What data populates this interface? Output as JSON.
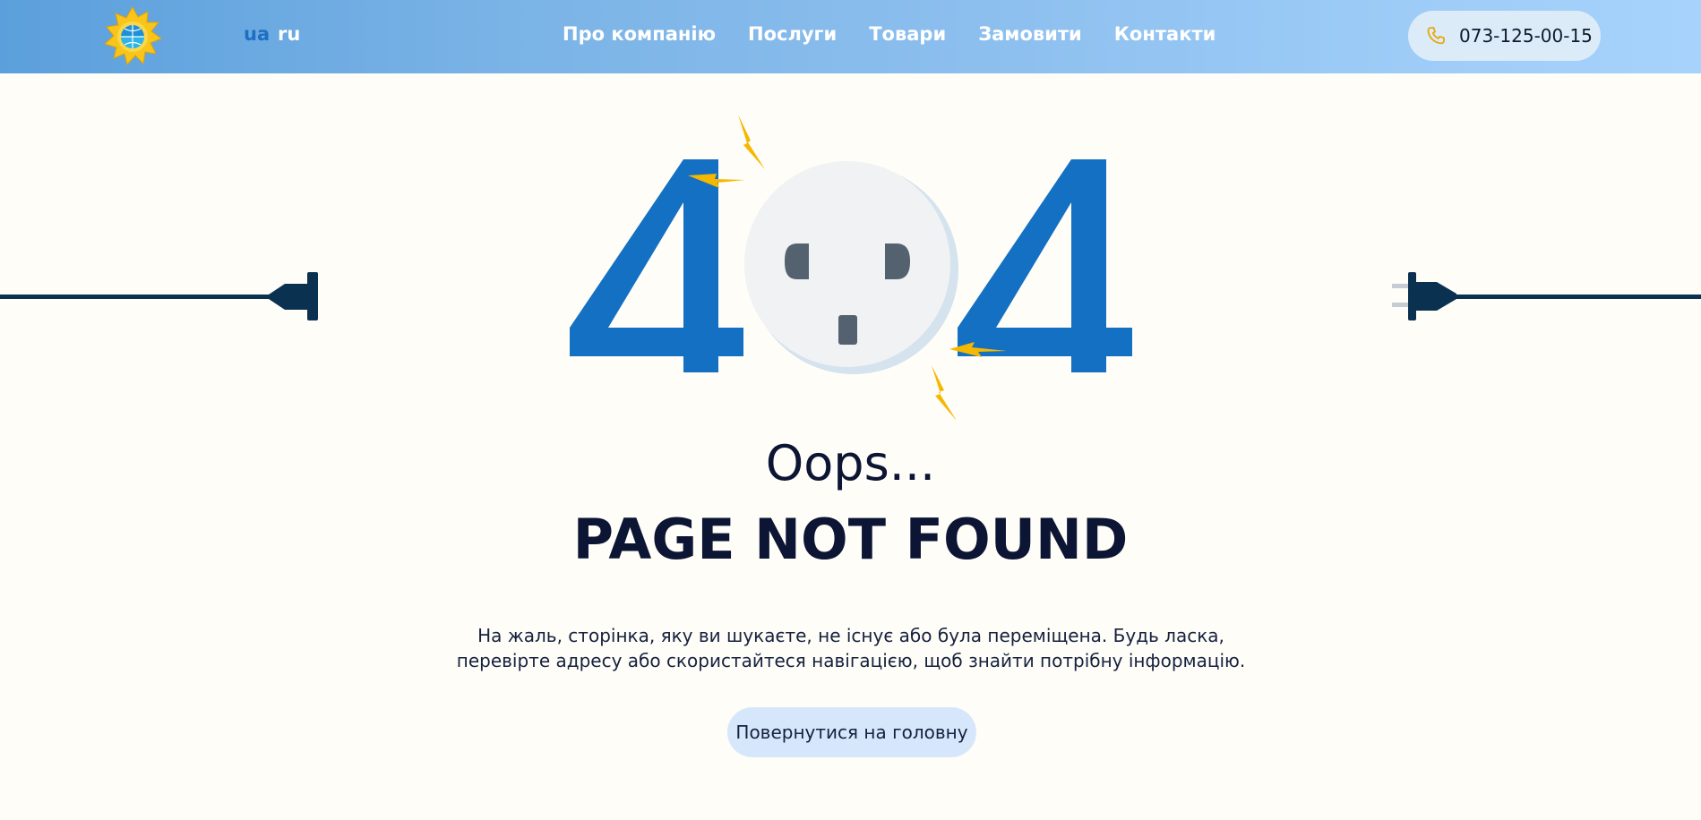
{
  "header": {
    "languages": [
      {
        "code": "ua",
        "label": "ua",
        "active": true
      },
      {
        "code": "ru",
        "label": "ru",
        "active": false
      }
    ],
    "nav": [
      {
        "label": "Про компанію"
      },
      {
        "label": "Послуги"
      },
      {
        "label": "Товари"
      },
      {
        "label": "Замовити"
      },
      {
        "label": "Контакти"
      }
    ],
    "phone": {
      "number": "073-125-00-15",
      "icon": "phone-icon"
    },
    "logo": {
      "icon": "sun-globe-logo"
    }
  },
  "illustration": {
    "digits": [
      "4",
      "4"
    ],
    "socket_icon": "power-socket-icon",
    "left_plug_icon": "plug-left-icon",
    "right_plug_icon": "plug-right-icon",
    "spark_icon": "lightning-bolt-icon"
  },
  "main": {
    "oops": "Oops...",
    "title": "PAGE NOT FOUND",
    "description_lines": [
      "На жаль, сторінка, яку ви шукаєте, не існує або була переміщена. Будь ласка,",
      "перевірте адресу або скористайтеся навігацією, щоб знайти потрібну інформацію."
    ],
    "home_button": "Повернутися на головну"
  },
  "colors": {
    "header_gradient_start": "#5b9fdc",
    "header_gradient_end": "#a6d3fb",
    "digit_blue": "#1370c2",
    "socket_face": "#f1f2f4",
    "socket_holes": "#546270",
    "cable_navy": "#0b3150",
    "spark_yellow": "#f5b800",
    "text_dark": "#0c1533",
    "button_bg": "#d7e7fb",
    "background": "#fefdf8"
  }
}
